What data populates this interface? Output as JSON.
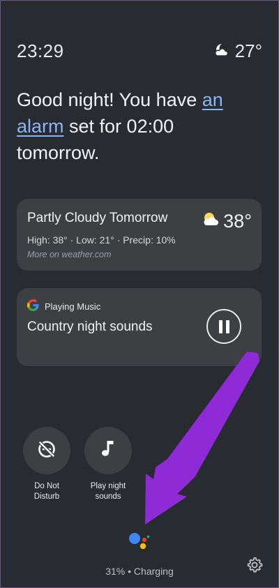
{
  "status_bar": {
    "time": "23:29",
    "temperature": "27°",
    "weather_icon": "moon-cloud-icon"
  },
  "greeting": {
    "before": "Good night! You have ",
    "link": "an alarm",
    "after": " set for 02:00 tomorrow."
  },
  "weather_card": {
    "title": "Partly Cloudy Tomorrow",
    "details": "High: 38° · Low: 21° · Precip: 10%",
    "source": "More on weather.com",
    "temperature": "38°",
    "icon": "sun-cloud-icon"
  },
  "music_card": {
    "app_label": "Playing Music",
    "app_icon": "google-g-icon",
    "title": "Country night sounds",
    "control_icon": "pause-icon"
  },
  "actions": [
    {
      "label_line1": "Do Not",
      "label_line2": "Disturb",
      "icon": "do-not-disturb-off-icon"
    },
    {
      "label_line1": "Play night",
      "label_line2": "sounds",
      "icon": "music-note-icon"
    }
  ],
  "footer": {
    "battery_status": "31% • Charging",
    "settings_icon": "gear-icon",
    "assistant_icon": "google-assistant-icon"
  },
  "colors": {
    "background": "#282b2f",
    "card": "#3c4043",
    "link": "#8ab4f8",
    "annotation_arrow": "#8e2bd6"
  }
}
